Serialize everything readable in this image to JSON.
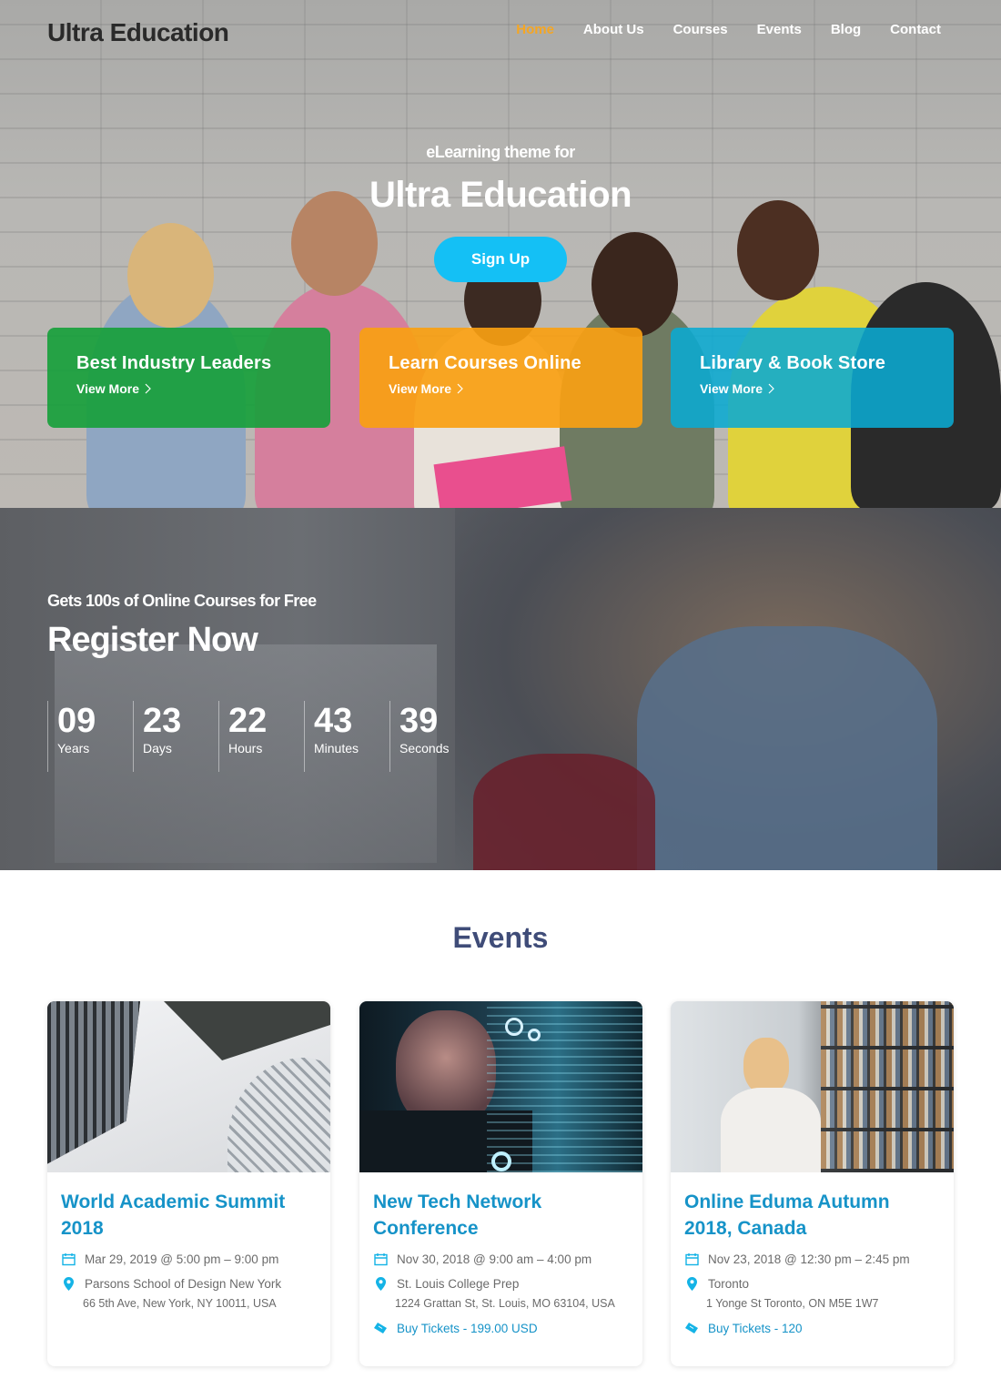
{
  "header": {
    "logo": "Ultra Education",
    "nav": [
      {
        "label": "Home",
        "active": true
      },
      {
        "label": "About Us",
        "active": false
      },
      {
        "label": "Courses",
        "active": false
      },
      {
        "label": "Events",
        "active": false
      },
      {
        "label": "Blog",
        "active": false
      },
      {
        "label": "Contact",
        "active": false
      }
    ],
    "nav_active_color": "#f5a623"
  },
  "hero": {
    "subtitle": "eLearning theme for",
    "title": "Ultra Education",
    "signup_label": "Sign Up",
    "signup_color": "#14c0f5"
  },
  "features": [
    {
      "title": "Best Industry Leaders",
      "link": "View More",
      "color": "#18a03c"
    },
    {
      "title": "Learn Courses Online",
      "link": "View More",
      "color": "#f8a012"
    },
    {
      "title": "Library & Book Store",
      "link": "View More",
      "color": "#0aaad2"
    }
  ],
  "register": {
    "subtitle": "Gets 100s of Online Courses for Free",
    "title": "Register Now",
    "countdown": [
      {
        "value": "09",
        "label": "Years"
      },
      {
        "value": "23",
        "label": "Days"
      },
      {
        "value": "22",
        "label": "Hours"
      },
      {
        "value": "43",
        "label": "Minutes"
      },
      {
        "value": "39",
        "label": "Seconds"
      }
    ]
  },
  "events": {
    "title": "Events",
    "items": [
      {
        "title": "World Academic Summit 2018",
        "date": "Mar 29, 2019 @ 5:00 pm – 9:00 pm",
        "venue": "Parsons School of Design New York",
        "address": "66 5th Ave, New York, NY 10011, USA",
        "tickets": null,
        "image": "skyscrapers-photo"
      },
      {
        "title": "New Tech Network Conference",
        "date": "Nov 30, 2018 @ 9:00 am – 4:00 pm",
        "venue": "St. Louis College Prep",
        "address": "1224 Grattan St, St. Louis, MO 63104, USA",
        "tickets": "Buy Tickets - 199.00 USD",
        "image": "tech-hologram-photo"
      },
      {
        "title": "Online Eduma Autumn 2018, Canada",
        "date": "Nov 23, 2018 @ 12:30 pm – 2:45 pm",
        "venue": "Toronto",
        "address": "1 Yonge St Toronto, ON M5E 1W7",
        "tickets": "Buy Tickets - 120",
        "image": "library-photo"
      }
    ]
  }
}
